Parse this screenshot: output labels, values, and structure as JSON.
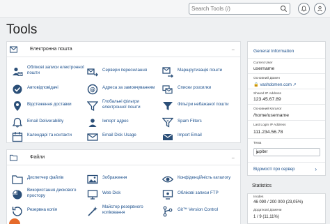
{
  "header": {
    "search_placeholder": "Search Tools (/)",
    "search_value": ""
  },
  "page_title": "Tools",
  "sections": {
    "email": {
      "title": "Електронна пошта",
      "tools": [
        {
          "label": "Облікові записи електронної пошти",
          "icon": "email-accounts-icon"
        },
        {
          "label": "Сервери пересилання",
          "icon": "forwarders-icon"
        },
        {
          "label": "Маршрутизація пошти",
          "icon": "email-routing-icon"
        },
        {
          "label": "Автовідповідачі",
          "icon": "autoresponders-icon"
        },
        {
          "label": "Адреса за замовчуванням",
          "icon": "default-address-icon"
        },
        {
          "label": "Списки розсилки",
          "icon": "mailing-lists-icon"
        },
        {
          "label": "Відстеження доставки",
          "icon": "track-delivery-icon"
        },
        {
          "label": "Глобальні фільтри електронної пошти",
          "icon": "global-filters-icon"
        },
        {
          "label": "Фільтри небажаної пошти",
          "icon": "email-filters-icon"
        },
        {
          "label": "Email Deliverability",
          "icon": "email-deliverability-icon"
        },
        {
          "label": "Імпорт адрес",
          "icon": "address-importer-icon"
        },
        {
          "label": "Spam Filters",
          "icon": "spam-filters-icon"
        },
        {
          "label": "Календарі та контакти",
          "icon": "calendars-contacts-icon"
        },
        {
          "label": "Email Disk Usage",
          "icon": "email-disk-usage-icon"
        },
        {
          "label": "Import Email",
          "icon": "import-email-icon"
        }
      ]
    },
    "files": {
      "title": "Файли",
      "tools": [
        {
          "label": "Диспетчер файлів",
          "icon": "file-manager-icon"
        },
        {
          "label": "Зображення",
          "icon": "images-icon"
        },
        {
          "label": "Конфіденційність каталогу",
          "icon": "directory-privacy-icon"
        },
        {
          "label": "Використання дискового простору",
          "icon": "disk-usage-icon"
        },
        {
          "label": "Web Disk",
          "icon": "web-disk-icon"
        },
        {
          "label": "Облікові записи FTP",
          "icon": "ftp-accounts-icon"
        },
        {
          "label": "Резервна копія",
          "icon": "backup-icon"
        },
        {
          "label": "Майстер резервного копіювання",
          "icon": "backup-wizard-icon"
        },
        {
          "label": "Git™ Version Control",
          "icon": "git-icon"
        }
      ]
    }
  },
  "general_info": {
    "title": "General Information",
    "current_user_label": "Current User",
    "current_user": "username",
    "primary_domain_label": "Основний Домен",
    "primary_domain": "vashdomen.com",
    "shared_ip_label": "Shared IP Address",
    "shared_ip": "123.45.67.89",
    "home_dir_label": "Основний Каталог",
    "home_dir": "/home/username",
    "last_login_label": "Last Login IP Address",
    "last_login_ip": "111.234.56.78",
    "theme_label": "Тема",
    "theme_value": "jupiter",
    "server_info_link": "Відомості про сервер"
  },
  "statistics": {
    "title": "Statistics",
    "inodes_label": "Inodes",
    "inodes_value": "46 090 / 200 000   (23,05%)",
    "addon_domains_label": "Додаткові Домени",
    "addon_domains_value": "1 / 9   (11,11%)"
  },
  "colors": {
    "link": "#1b4f8c",
    "background": "#eef0f2",
    "icon": "#2b4f78",
    "accent_orange": "#e56a2a"
  }
}
